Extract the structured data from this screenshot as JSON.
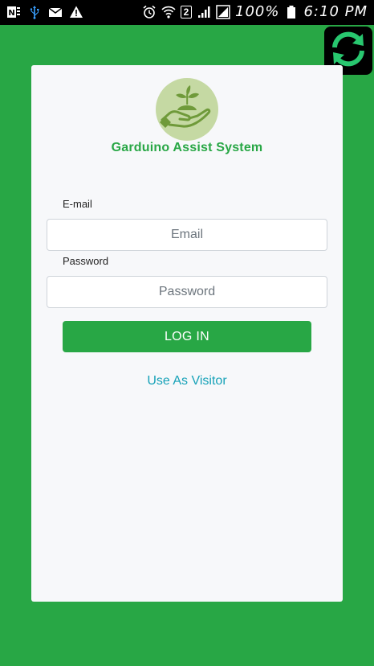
{
  "status_bar": {
    "left_icons": [
      "onenote-icon",
      "usb-icon",
      "mail-icon",
      "warning-icon"
    ],
    "sim_slot": "2",
    "battery_text": "100%",
    "time": "6:10 PM"
  },
  "app": {
    "title": "Garduino Assist System",
    "email_label": "E-mail",
    "email_placeholder": "Email",
    "password_label": "Password",
    "password_placeholder": "Password",
    "login_label": "LOG IN",
    "visitor_label": "Use As Visitor"
  },
  "colors": {
    "background": "#28a745",
    "card": "#f7f8fa",
    "link": "#17a2b8",
    "logo_bg": "#c5d9a3",
    "logo_plant": "#6f9a3a"
  }
}
